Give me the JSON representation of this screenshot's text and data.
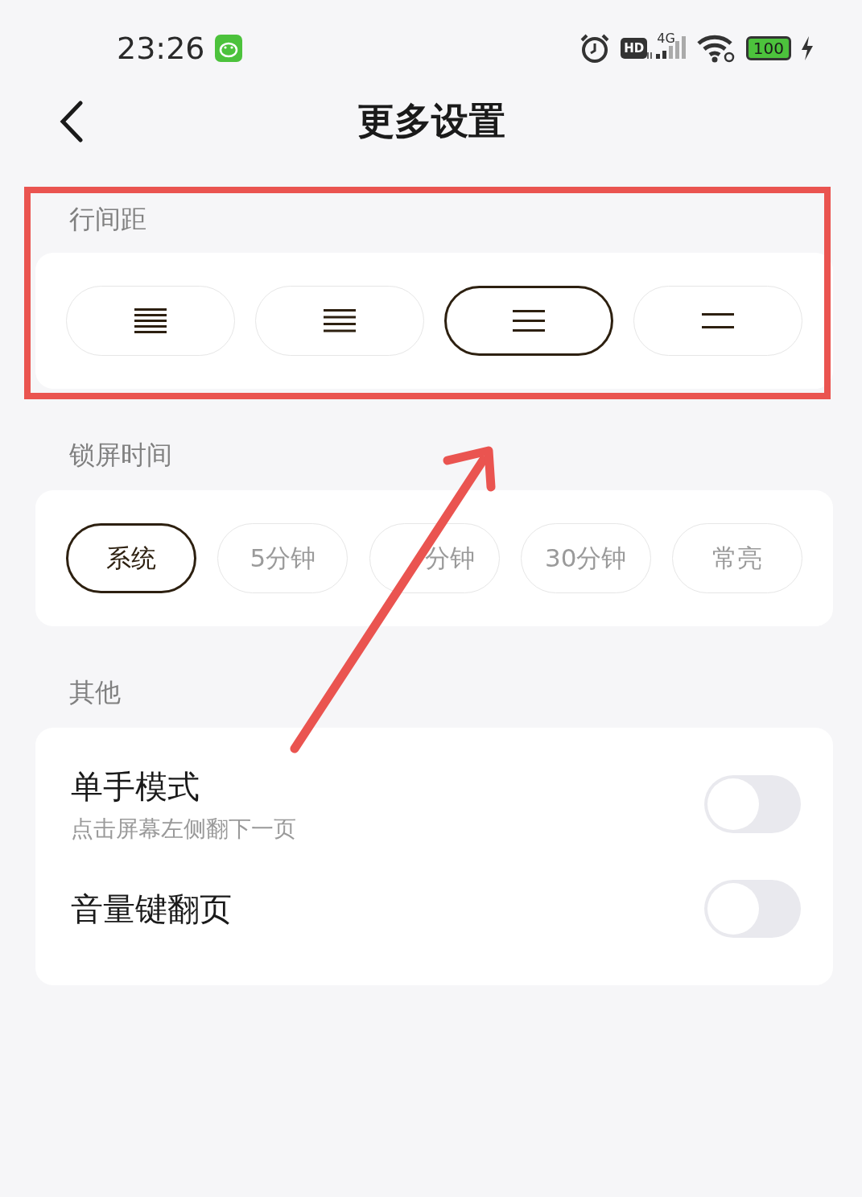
{
  "status_bar": {
    "time": "23:26",
    "hd": "HD",
    "network": "4G",
    "battery": "100"
  },
  "header": {
    "title": "更多设置"
  },
  "line_spacing": {
    "label": "行间距",
    "options": [
      {
        "kind": "tightest",
        "selected": false
      },
      {
        "kind": "tight",
        "selected": false
      },
      {
        "kind": "loose",
        "selected": true
      },
      {
        "kind": "loosest",
        "selected": false
      }
    ]
  },
  "lock_time": {
    "label": "锁屏时间",
    "options": [
      {
        "label": "系统",
        "selected": true
      },
      {
        "label": "5分钟",
        "selected": false
      },
      {
        "label": "分钟",
        "selected": false,
        "kind": "covered"
      },
      {
        "label": "30分钟",
        "selected": false
      },
      {
        "label": "常亮",
        "selected": false
      }
    ]
  },
  "other": {
    "label": "其他",
    "items": [
      {
        "title": "单手模式",
        "subtitle": "点击屏幕左侧翻下一页",
        "on": false
      },
      {
        "title": "音量键翻页",
        "on": false
      }
    ]
  }
}
